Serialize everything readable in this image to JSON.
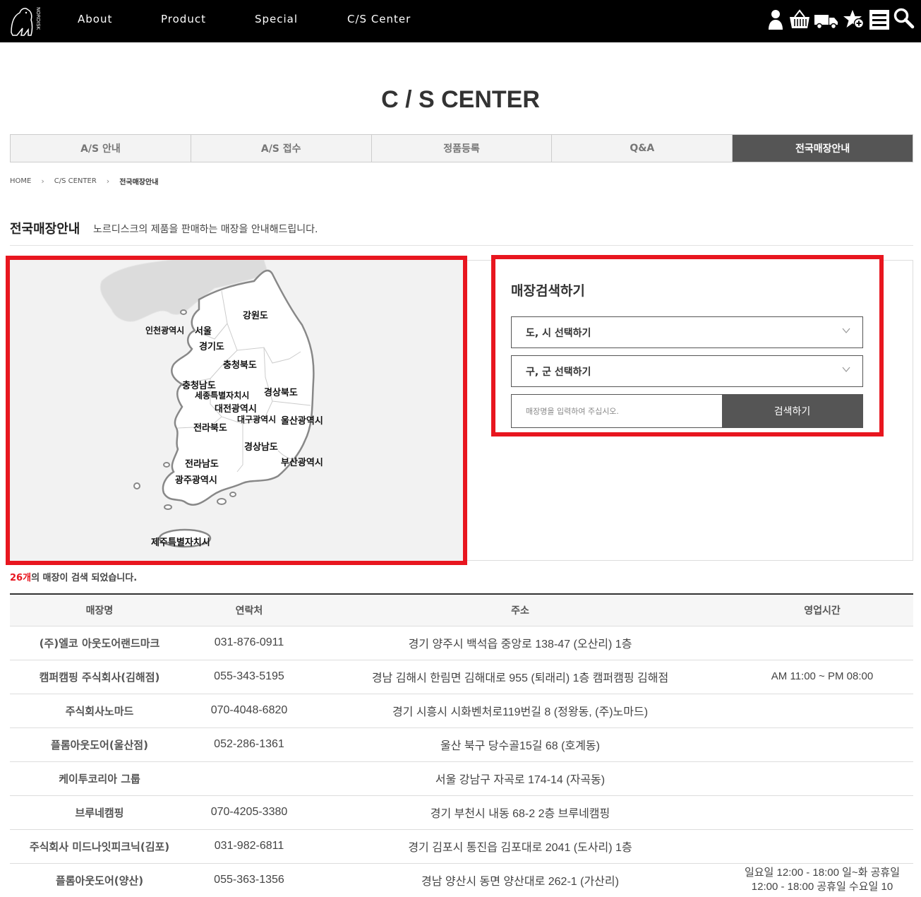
{
  "nav": {
    "logo_alt": "NORDISK",
    "items": [
      "About",
      "Product",
      "Special",
      "C/S Center"
    ],
    "icons": [
      "user-icon",
      "basket-icon",
      "truck-icon",
      "star-plus-icon",
      "menu-icon",
      "search-icon"
    ]
  },
  "page": {
    "title": "C / S CENTER"
  },
  "tabs": [
    {
      "label": "A/S 안내",
      "active": false
    },
    {
      "label": "A/S 접수",
      "active": false
    },
    {
      "label": "정품등록",
      "active": false
    },
    {
      "label": "Q&A",
      "active": false
    },
    {
      "label": "전국매장안내",
      "active": true
    }
  ],
  "breadcrumb": [
    "HOME",
    "C/S CENTER",
    "전국매장안내"
  ],
  "section": {
    "heading": "전국매장안내",
    "description": "노르디스크의 제품을 판매하는 매장을 안내해드립니다."
  },
  "map": {
    "regions": [
      "강원도",
      "인천광역시",
      "서울",
      "경기도",
      "충청북도",
      "충청남도",
      "세종특별자치시",
      "경상북도",
      "대전광역시",
      "대구광역시",
      "울산광역시",
      "전라북도",
      "경상남도",
      "전라남도",
      "부산광역시",
      "광주광역시",
      "제주특별자치시"
    ]
  },
  "search": {
    "title": "매장검색하기",
    "province_select": "도, 시 선택하기",
    "district_select": "구, 군 선택하기",
    "input_placeholder": "매장명을 입력하여 주십시오.",
    "button": "검색하기"
  },
  "results": {
    "count": "26개",
    "suffix": "의 매장이 검색 되었습니다."
  },
  "table": {
    "headers": [
      "매장명",
      "연락처",
      "주소",
      "영업시간"
    ],
    "rows": [
      {
        "name": "(주)엘코 아웃도어랜드마크",
        "phone": "031-876-0911",
        "address": "경기 양주시 백석읍 중앙로 138-47 (오산리) 1층",
        "hours": ""
      },
      {
        "name": "캠퍼캠핑 주식회사(김해점)",
        "phone": "055-343-5195",
        "address": "경남 김해시 한림면 김해대로 955 (퇴래리) 1층 캠퍼캠핑 김해점",
        "hours": "AM 11:00 ~ PM 08:00"
      },
      {
        "name": "주식회사노마드",
        "phone": "070-4048-6820",
        "address": "경기 시흥시 시화벤처로119번길 8 (정왕동, (주)노마드)",
        "hours": ""
      },
      {
        "name": "플롬아웃도어(울산점)",
        "phone": "052-286-1361",
        "address": "울산 북구 당수골15길 68 (호계동)",
        "hours": ""
      },
      {
        "name": "케이투코리아 그룹",
        "phone": "",
        "address": "서울 강남구 자곡로 174-14 (자곡동)",
        "hours": ""
      },
      {
        "name": "브루네캠핑",
        "phone": "070-4205-3380",
        "address": "경기 부천시 내동 68-2 2층 브루네캠핑",
        "hours": ""
      },
      {
        "name": "주식회사 미드나잇피크닉(김포)",
        "phone": "031-982-6811",
        "address": "경기 김포시 통진읍 김포대로 2041 (도사리) 1층",
        "hours": ""
      },
      {
        "name": "플롬아웃도어(양산)",
        "phone": "055-363-1356",
        "address": "경남 양산시 동면 양산대로 262-1 (가산리)",
        "hours": "일요일 12:00 - 18:00 일~화 공휴일 12:00 - 18:00 공휴일 수요일 10"
      }
    ]
  }
}
